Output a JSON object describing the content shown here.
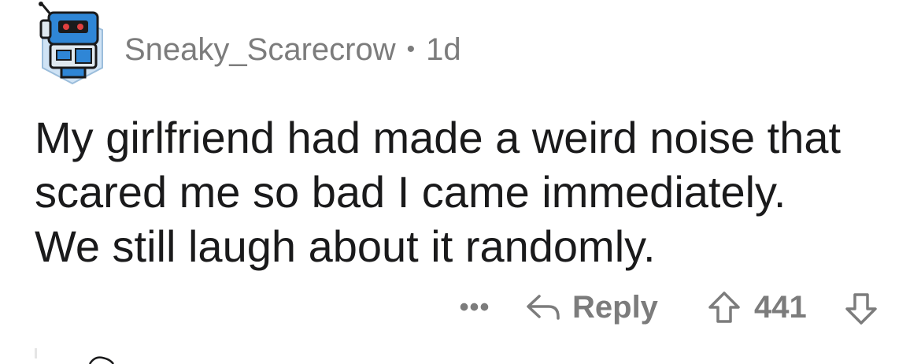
{
  "comment": {
    "username": "Sneaky_Scarecrow",
    "separator": "•",
    "age": "1d",
    "lines": [
      "My girlfriend had made a weird noise that",
      "scared me so bad I came immediately.",
      "We still laugh about it randomly."
    ],
    "actions": {
      "more_label": "•••",
      "reply_label": "Reply",
      "score": "441"
    }
  },
  "icons": {
    "avatar": "robot-avatar-icon",
    "reply": "reply-arrow-icon",
    "upvote": "upvote-arrow-icon",
    "downvote": "downvote-arrow-icon"
  },
  "colors": {
    "meta_text": "#7c7c7c",
    "body_text": "#1a1a1b",
    "avatar_bg": "#cfe3f5",
    "avatar_robot": "#2f86d6"
  }
}
